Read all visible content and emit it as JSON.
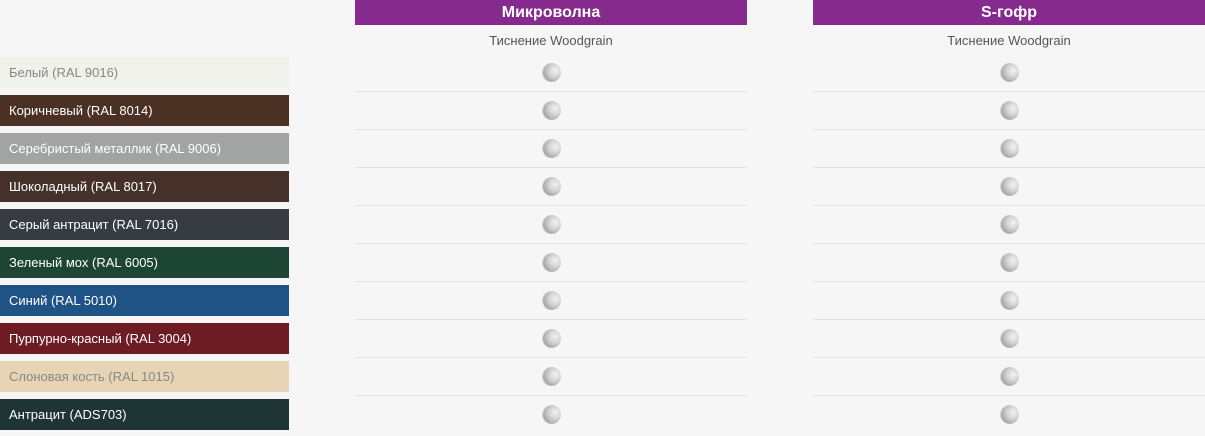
{
  "columns": [
    {
      "title": "Микроволна",
      "subtitle": "Тиснение Woodgrain"
    },
    {
      "title": "S-гофр",
      "subtitle": "Тиснение Woodgrain"
    }
  ],
  "header_color": "#862a8e",
  "available_icon": "textured-sample-icon",
  "colors": [
    {
      "label": "Белый (RAL 9016)",
      "bg": "#f0f1eb",
      "fg": "#888888"
    },
    {
      "label": "Коричневый (RAL 8014)",
      "bg": "#4a3124",
      "fg": "#ffffff"
    },
    {
      "label": "Серебристый металлик (RAL 9006)",
      "bg": "#a2a3a3",
      "fg": "#ffffff"
    },
    {
      "label": "Шоколадный (RAL 8017)",
      "bg": "#45302a",
      "fg": "#ffffff"
    },
    {
      "label": "Серый антрацит (RAL 7016)",
      "bg": "#373c42",
      "fg": "#ffffff"
    },
    {
      "label": "Зеленый мох (RAL 6005)",
      "bg": "#1c4533",
      "fg": "#ffffff"
    },
    {
      "label": "Синий (RAL 5010)",
      "bg": "#1f5385",
      "fg": "#ffffff"
    },
    {
      "label": "Пурпурно-красный (RAL 3004)",
      "bg": "#6d1c23",
      "fg": "#ffffff"
    },
    {
      "label": "Слоновая кость (RAL 1015)",
      "bg": "#e7d4b4",
      "fg": "#888888"
    },
    {
      "label": "Антрацит (ADS703)",
      "bg": "#1f3434",
      "fg": "#ffffff"
    }
  ]
}
